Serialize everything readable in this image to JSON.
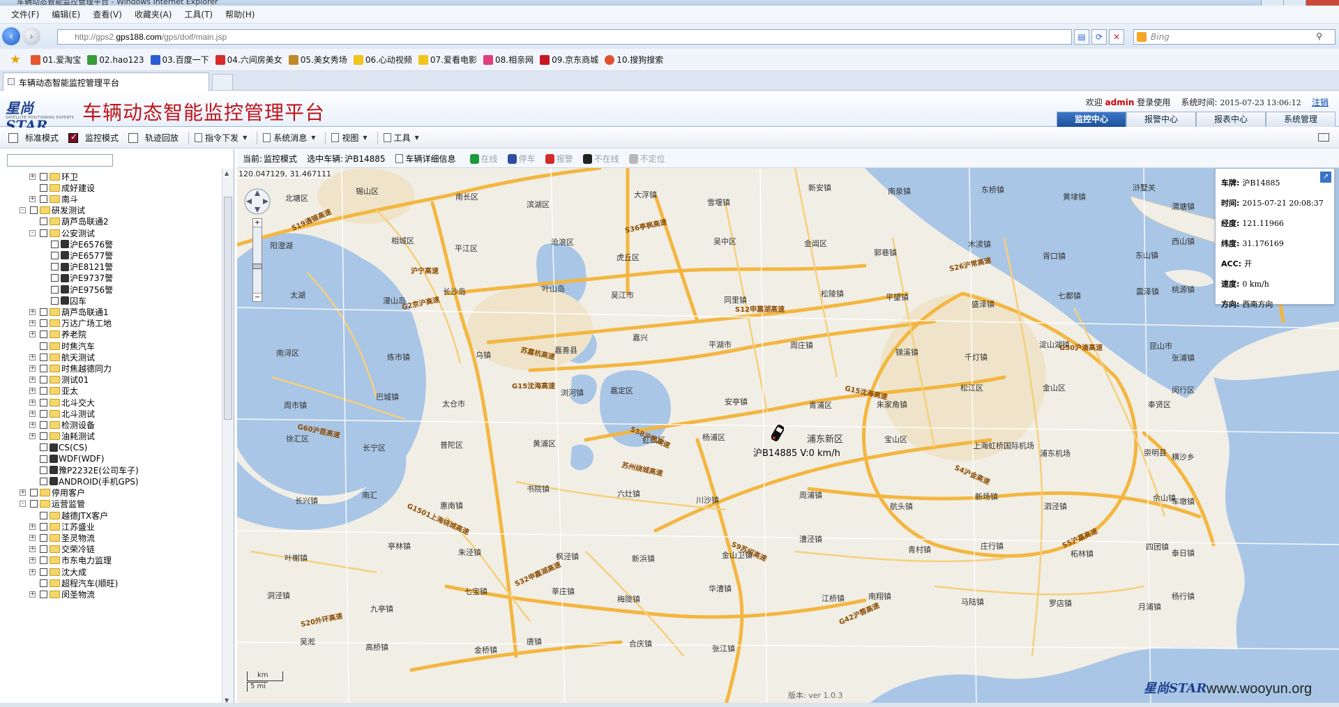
{
  "browser": {
    "window_title": "车辆动态智能监控管理平台 - Windows Internet Explorer",
    "menu": [
      "文件(F)",
      "编辑(E)",
      "查看(V)",
      "收藏夹(A)",
      "工具(T)",
      "帮助(H)"
    ],
    "url_prefix": "http://gps2.",
    "url_host": "gps188.com",
    "url_path": "/gps/doif/main.jsp",
    "search_placeholder": "Bing",
    "favorites": [
      {
        "label": "01.爱淘宝",
        "color": "#e4572e"
      },
      {
        "label": "02.hao123",
        "color": "#3a9b3a"
      },
      {
        "label": "03.百度一下",
        "color": "#2b5cd6"
      },
      {
        "label": "04.六间房美女",
        "color": "#d62b2b"
      },
      {
        "label": "05.美女秀场",
        "color": "#c08a2a"
      },
      {
        "label": "06.心动视频",
        "color": "#f0c419"
      },
      {
        "label": "07.爱看电影",
        "color": "#f0c419"
      },
      {
        "label": "08.相亲网",
        "color": "#e0407a"
      },
      {
        "label": "09.京东商城",
        "color": "#c81623"
      },
      {
        "label": "10.搜狗搜索",
        "color": "#e05030"
      }
    ],
    "tab_title": "车辆动态智能监控管理平台"
  },
  "header": {
    "logo_text": "星尚STAR",
    "logo_sub": "SATELLITE POSITIONING EXPERTS",
    "title": "车辆动态智能监控管理平台",
    "welcome": "欢迎",
    "user": "admin",
    "login_suffix": "登录使用",
    "time_label": "系统时间:",
    "time_value": "2015-07-23 13:06:12",
    "logout": "注销",
    "nav_tabs": [
      "监控中心",
      "报警中心",
      "报表中心",
      "系统管理"
    ]
  },
  "toolbar": {
    "modes": [
      {
        "label": "标准模式",
        "checked": false
      },
      {
        "label": "监控模式",
        "checked": true
      },
      {
        "label": "轨迹回放",
        "checked": false
      }
    ],
    "menus": [
      "指令下发",
      "系统消息",
      "视图",
      "工具"
    ]
  },
  "status": {
    "current_label": "当前:",
    "current_value": "监控模式",
    "selected_label": "选中车辆:",
    "selected_value": "沪B14885",
    "detail_label": "车辆详细信息",
    "legend": [
      {
        "label": "在线",
        "color": "#1c9a3a"
      },
      {
        "label": "停车",
        "color": "#2d4fa3"
      },
      {
        "label": "报警",
        "color": "#d22b2b"
      },
      {
        "label": "不在线",
        "color": "#222222"
      },
      {
        "label": "不定位",
        "color": "#b8b8b8"
      }
    ]
  },
  "tree": [
    {
      "label": "环卫",
      "level": 2,
      "expander": "+",
      "icon": "folder"
    },
    {
      "label": "成好建设",
      "level": 2,
      "expander": "",
      "icon": "folder"
    },
    {
      "label": "南斗",
      "level": 2,
      "expander": "+",
      "icon": "folder"
    },
    {
      "label": "研发测试",
      "level": 1,
      "expander": "-",
      "icon": "folder"
    },
    {
      "label": "葫芦岛联通2",
      "level": 2,
      "expander": "",
      "icon": "folder"
    },
    {
      "label": "公安测试",
      "level": 2,
      "expander": "-",
      "icon": "folder"
    },
    {
      "label": "沪E6576警",
      "level": 3,
      "expander": "",
      "icon": "car"
    },
    {
      "label": "沪E6577警",
      "level": 3,
      "expander": "",
      "icon": "car"
    },
    {
      "label": "沪E8121警",
      "level": 3,
      "expander": "",
      "icon": "car"
    },
    {
      "label": "沪E9737警",
      "level": 3,
      "expander": "",
      "icon": "car"
    },
    {
      "label": "沪E9756警",
      "level": 3,
      "expander": "",
      "icon": "car"
    },
    {
      "label": "囚车",
      "level": 3,
      "expander": "",
      "icon": "car"
    },
    {
      "label": "葫芦岛联通1",
      "level": 2,
      "expander": "+",
      "icon": "folder"
    },
    {
      "label": "万达广场工地",
      "level": 2,
      "expander": "+",
      "icon": "folder"
    },
    {
      "label": "养老院",
      "level": 2,
      "expander": "+",
      "icon": "folder"
    },
    {
      "label": "时焦汽车",
      "level": 2,
      "expander": "",
      "icon": "folder"
    },
    {
      "label": "航天测试",
      "level": 2,
      "expander": "+",
      "icon": "folder"
    },
    {
      "label": "时焦越德同力",
      "level": 2,
      "expander": "+",
      "icon": "folder"
    },
    {
      "label": "测试01",
      "level": 2,
      "expander": "+",
      "icon": "folder"
    },
    {
      "label": "亚太",
      "level": 2,
      "expander": "+",
      "icon": "folder"
    },
    {
      "label": "北斗交大",
      "level": 2,
      "expander": "+",
      "icon": "folder"
    },
    {
      "label": "北斗测试",
      "level": 2,
      "expander": "+",
      "icon": "folder"
    },
    {
      "label": "检测设备",
      "level": 2,
      "expander": "+",
      "icon": "folder"
    },
    {
      "label": "油耗测试",
      "level": 2,
      "expander": "+",
      "icon": "folder"
    },
    {
      "label": "CS(CS)",
      "level": 2,
      "expander": "",
      "icon": "car"
    },
    {
      "label": "WDF(WDF)",
      "level": 2,
      "expander": "",
      "icon": "car"
    },
    {
      "label": "豫P2232E(公司车子)",
      "level": 2,
      "expander": "",
      "icon": "car"
    },
    {
      "label": "ANDROID(手机GPS)",
      "level": 2,
      "expander": "",
      "icon": "car"
    },
    {
      "label": "停用客户",
      "level": 1,
      "expander": "+",
      "icon": "folder"
    },
    {
      "label": "运营监管",
      "level": 1,
      "expander": "-",
      "icon": "folder"
    },
    {
      "label": "越德JTX客户",
      "level": 2,
      "expander": "",
      "icon": "folder"
    },
    {
      "label": "江苏盛业",
      "level": 2,
      "expander": "+",
      "icon": "folder"
    },
    {
      "label": "圣灵物流",
      "level": 2,
      "expander": "+",
      "icon": "folder"
    },
    {
      "label": "交荣冷链",
      "level": 2,
      "expander": "+",
      "icon": "folder"
    },
    {
      "label": "市东电力监理",
      "level": 2,
      "expander": "+",
      "icon": "folder"
    },
    {
      "label": "沈大成",
      "level": 2,
      "expander": "+",
      "icon": "folder"
    },
    {
      "label": "超程汽车(顺旺)",
      "level": 2,
      "expander": "",
      "icon": "folder"
    },
    {
      "label": "闵圣物流",
      "level": 2,
      "expander": "+",
      "icon": "folder"
    }
  ],
  "map": {
    "coord_readout": "120.047129, 31.467111",
    "vehicle_label": "沪B14885 V:0 km/h",
    "scale_km": "km",
    "scale_mi": "5 mi",
    "version": "版本: ver 1.0.3",
    "logo": "星尚STAR",
    "watermark": "www.wooyun.org",
    "places": [
      "北塘区",
      "锡山区",
      "南长区",
      "滨湖区",
      "大浮镇",
      "雪堰镇",
      "新安镇",
      "南泉镇",
      "东桥镇",
      "黄埭镇",
      "浒墅关",
      "渭塘镇",
      "阳澄湖",
      "相城区",
      "平江区",
      "沧浪区",
      "虎丘区",
      "吴中区",
      "金阊区",
      "郭巷镇",
      "木渎镇",
      "胥口镇",
      "东山镇",
      "西山镇",
      "太湖",
      "漫山岛",
      "长沙岛",
      "叶山岛",
      "吴江市",
      "同里镇",
      "松陵镇",
      "平望镇",
      "盛泽镇",
      "七都镇",
      "震泽镇",
      "桃源镇",
      "南浔区",
      "练市镇",
      "乌镇",
      "嘉善县",
      "嘉兴",
      "平湖市",
      "周庄镇",
      "锦溪镇",
      "千灯镇",
      "淀山湖镇",
      "昆山市",
      "张浦镇",
      "周市镇",
      "巴城镇",
      "太仓市",
      "浏河镇",
      "嘉定区",
      "安亭镇",
      "青浦区",
      "朱家角镇",
      "松江区",
      "金山区",
      "奉贤区",
      "闵行区",
      "徐汇区",
      "长宁区",
      "普陀区",
      "黄浦区",
      "虹口区",
      "杨浦区",
      "浦东新区",
      "宝山区",
      "上海虹桥国际机场",
      "浦东机场",
      "崇明县",
      "横沙乡",
      "长兴镇",
      "南汇",
      "惠南镇",
      "书院镇",
      "六灶镇",
      "川沙镇",
      "周浦镇",
      "航头镇",
      "新场镇",
      "泗泾镇",
      "佘山镇",
      "车墩镇",
      "叶榭镇",
      "亭林镇",
      "朱泾镇",
      "枫泾镇",
      "新浜镇",
      "金山卫镇",
      "漕泾镇",
      "青村镇",
      "庄行镇",
      "柘林镇",
      "四团镇",
      "泰日镇",
      "洞泾镇",
      "九亭镇",
      "七宝镇",
      "莘庄镇",
      "梅陇镇",
      "华漕镇",
      "江桥镇",
      "南翔镇",
      "马陆镇",
      "罗店镇",
      "月浦镇",
      "杨行镇",
      "吴淞",
      "高桥镇",
      "金桥镇",
      "唐镇",
      "合庆镇",
      "张江镇"
    ],
    "roads": [
      "S19通锡高速",
      "G2京沪高速",
      "G15沈海高速",
      "苏州绕城高速",
      "S9苏绍高速",
      "G42沪蓉高速",
      "S26沪常高速",
      "G50沪渝高速",
      "G60沪昆高速",
      "G1501上海绕城高速",
      "S32申嘉湖高速",
      "S36亭枫高速",
      "S12申嘉湖高速",
      "G15沈海高速",
      "S4沪金高速",
      "S5沪嘉高速",
      "S20外环高速",
      "沪宁高速",
      "苏嘉杭高速",
      "S58沪常高速"
    ]
  },
  "infobox": {
    "rows": [
      {
        "k": "车牌:",
        "v": "沪B14885"
      },
      {
        "k": "时间:",
        "v": "2015-07-21 20:08:37"
      },
      {
        "k": "经度:",
        "v": "121.11966"
      },
      {
        "k": "纬度:",
        "v": "31.176169"
      },
      {
        "k": "ACC:",
        "v": "开"
      },
      {
        "k": "速度:",
        "v": "0 km/h"
      },
      {
        "k": "方向:",
        "v": "西南方向"
      }
    ]
  }
}
